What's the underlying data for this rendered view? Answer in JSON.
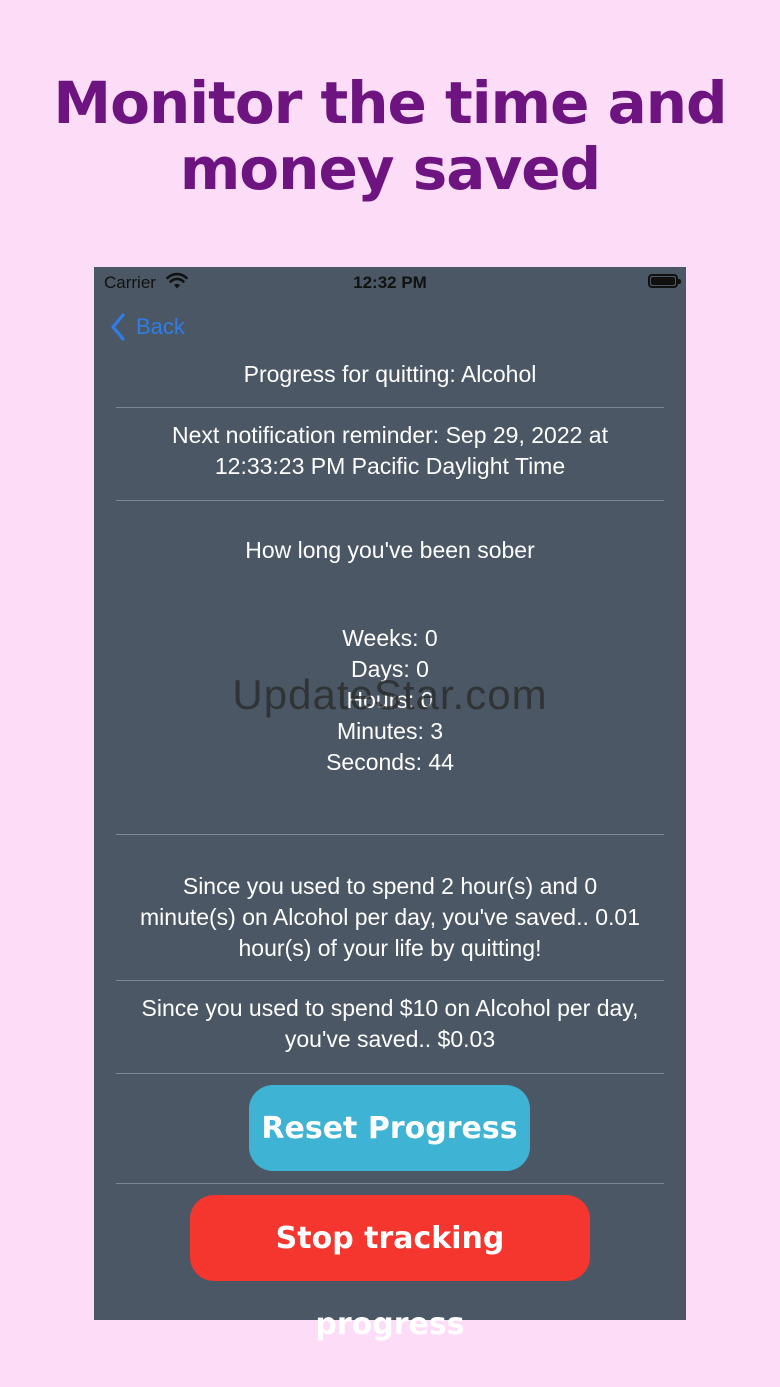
{
  "headline": {
    "line1": "Monitor the time and",
    "line2": "money saved"
  },
  "status_bar": {
    "carrier": "Carrier",
    "time": "12:32 PM"
  },
  "nav": {
    "back_label": "Back"
  },
  "progress": {
    "title": "Progress for quitting: Alcohol",
    "notification_line1": "Next notification reminder: Sep 29, 2022 at",
    "notification_line2": "12:33:23 PM Pacific Daylight Time",
    "sober_heading": "How long you've been sober",
    "weeks": "Weeks: 0",
    "days": "Days: 0",
    "hours": "Hours: 0",
    "minutes": "Minutes: 3",
    "seconds": "Seconds: 44",
    "time_saved_line1": "Since you used to spend 2 hour(s) and 0",
    "time_saved_line2": "minute(s) on Alcohol per day, you've saved.. 0.01",
    "time_saved_line3": "hour(s) of your life by quitting!",
    "money_saved_line1": "Since you used to spend $10 on Alcohol per day,",
    "money_saved_line2": "you've saved.. $0.03"
  },
  "watermark": "UpdateStar.com",
  "buttons": {
    "reset": "Reset Progress",
    "stop": "Stop tracking progress"
  },
  "colors": {
    "page_background": "#fcdcf7",
    "headline": "#6e1480",
    "screen_background": "#4b5764",
    "back_link": "#2f7de6",
    "reset_button": "#3eb3d4",
    "stop_button": "#f5362f"
  }
}
